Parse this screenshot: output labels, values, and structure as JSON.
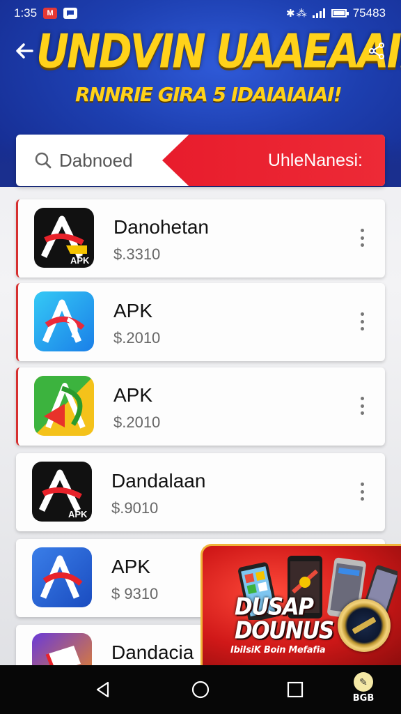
{
  "status_bar": {
    "time": "1:35",
    "notification_app_1": "M",
    "notification_app_2": "",
    "status_glyphs": "✱ ⁂",
    "right_text": "75483"
  },
  "header": {
    "back_icon": "arrow-left-icon",
    "share_icon": "share-icon",
    "title": "UNDVIN UAAEAAII",
    "subtitle": "RNNRIE GIRA 5 IDAIAIAIAI!"
  },
  "search": {
    "placeholder": "Dabnoed",
    "action_label": "UhleNanesi:",
    "icon": "search-icon"
  },
  "apps": [
    {
      "name": "Danohetan",
      "price": "$.3310",
      "icon_style": "apk-black",
      "accent": true
    },
    {
      "name": "APK",
      "price": "$.2010",
      "icon_style": "apk-blue-light",
      "accent": true
    },
    {
      "name": "APK",
      "price": "$.2010",
      "icon_style": "apk-green",
      "accent": true
    },
    {
      "name": "Dandalaan",
      "price": "$.9010",
      "icon_style": "apk-black",
      "accent": false
    },
    {
      "name": "APK",
      "price": "$ 9310",
      "icon_style": "apk-blue-dark",
      "accent": false
    },
    {
      "name": "Dandacia",
      "price": "",
      "icon_style": "apk-purple",
      "accent": false
    }
  ],
  "apk_badge_label": "APK",
  "promo": {
    "title_line1": "DUSAP",
    "title_line2": "DOUNUS",
    "caption": "IbiIsiK Boin Mefafia"
  },
  "nav": {
    "back": "triangle-back-icon",
    "home": "circle-home-icon",
    "recents": "square-recents-icon",
    "corner_label": "BGB"
  },
  "colors": {
    "header_blue": "#1d3fb0",
    "title_yellow": "#ffd21a",
    "accent_red": "#e81c2c"
  }
}
